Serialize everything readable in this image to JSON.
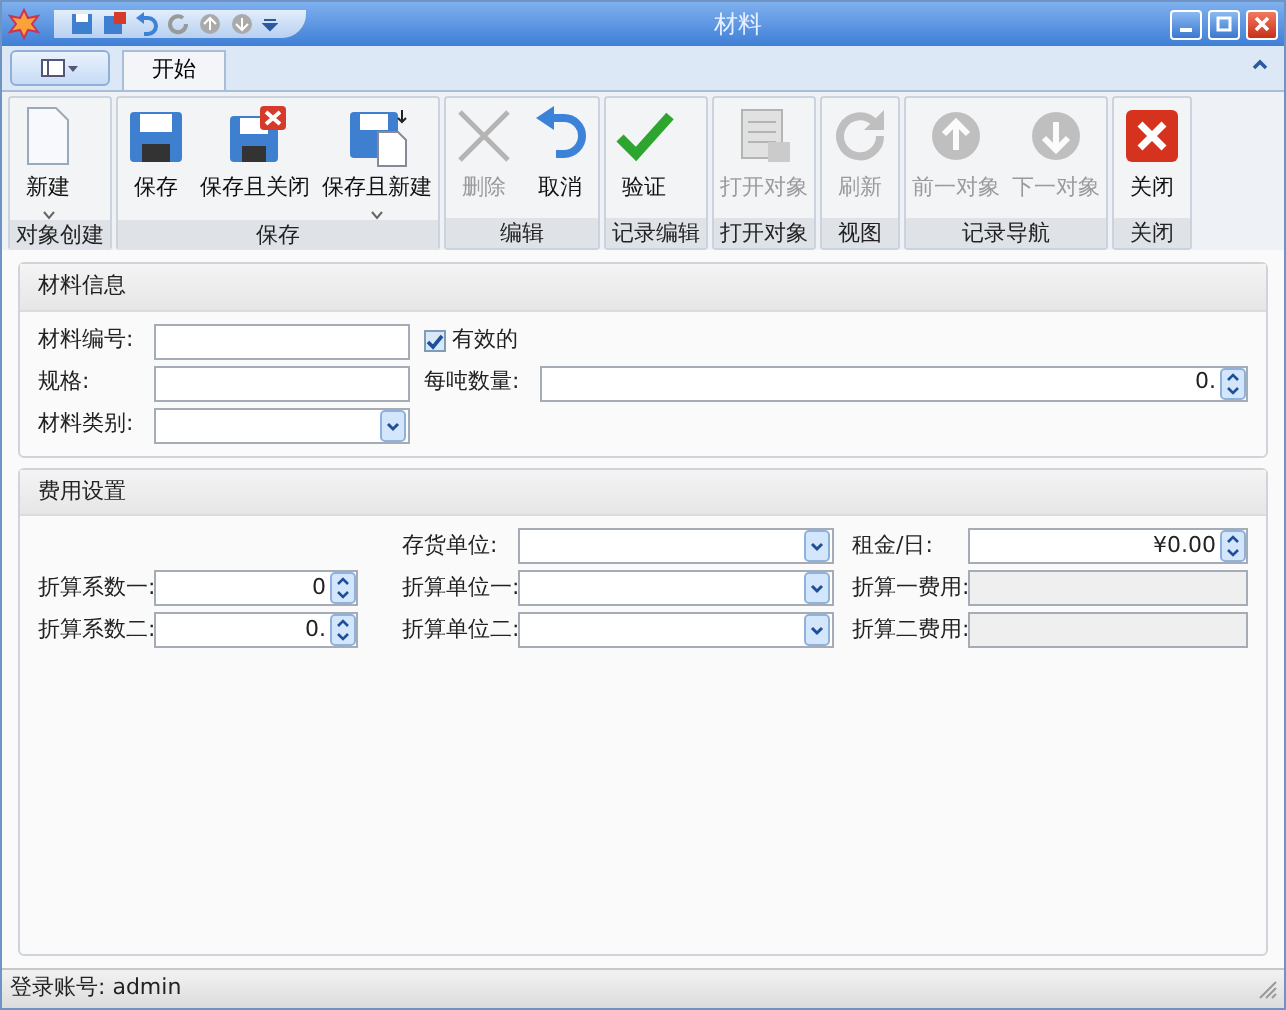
{
  "window": {
    "title": "材料"
  },
  "ribbon": {
    "tabs": [
      {
        "label": "开始",
        "selected": true
      }
    ],
    "groups": [
      {
        "label": "对象创建",
        "buttons": [
          {
            "label": "新建",
            "kind": "new",
            "disabled": false,
            "dropdown": true
          }
        ]
      },
      {
        "label": "保存",
        "buttons": [
          {
            "label": "保存",
            "kind": "save",
            "disabled": false,
            "dropdown": false
          },
          {
            "label": "保存且关闭",
            "kind": "save-close",
            "disabled": false,
            "dropdown": false
          },
          {
            "label": "保存且新建",
            "kind": "save-new",
            "disabled": false,
            "dropdown": true
          }
        ]
      },
      {
        "label": "编辑",
        "buttons": [
          {
            "label": "删除",
            "kind": "delete",
            "disabled": true,
            "dropdown": false
          },
          {
            "label": "取消",
            "kind": "undo",
            "disabled": false,
            "dropdown": false
          }
        ]
      },
      {
        "label": "记录编辑",
        "buttons": [
          {
            "label": "验证",
            "kind": "check",
            "disabled": false,
            "dropdown": false
          }
        ]
      },
      {
        "label": "打开对象",
        "buttons": [
          {
            "label": "打开对象",
            "kind": "open",
            "disabled": true,
            "dropdown": false
          }
        ]
      },
      {
        "label": "视图",
        "buttons": [
          {
            "label": "刷新",
            "kind": "refresh",
            "disabled": true,
            "dropdown": false
          }
        ]
      },
      {
        "label": "记录导航",
        "buttons": [
          {
            "label": "前一对象",
            "kind": "up",
            "disabled": true,
            "dropdown": false
          },
          {
            "label": "下一对象",
            "kind": "down",
            "disabled": true,
            "dropdown": false
          }
        ]
      },
      {
        "label": "关闭",
        "buttons": [
          {
            "label": "关闭",
            "kind": "close",
            "disabled": false,
            "dropdown": false
          }
        ]
      }
    ]
  },
  "sections": [
    {
      "title": "材料信息",
      "fields": [
        {
          "label": "材料编号:",
          "kind": "text"
        },
        {
          "label": "有效的",
          "kind": "checkbox",
          "checked": true
        },
        {
          "label": "规格:",
          "kind": "text"
        },
        {
          "label": "每吨数量:",
          "kind": "spin",
          "value": "0."
        },
        {
          "label": "材料类别:",
          "kind": "combo"
        }
      ]
    },
    {
      "title": "费用设置",
      "fields": [
        {
          "label": "存货单位:",
          "kind": "combo"
        },
        {
          "label": "租金/日:",
          "kind": "spin",
          "value": "¥0.00"
        },
        {
          "label": "折算系数一:",
          "kind": "spin",
          "value": "0"
        },
        {
          "label": "折算单位一:",
          "kind": "combo"
        },
        {
          "label": "折算一费用:",
          "kind": "readonly"
        },
        {
          "label": "折算系数二:",
          "kind": "spin",
          "value": "0."
        },
        {
          "label": "折算单位二:",
          "kind": "combo"
        },
        {
          "label": "折算二费用:",
          "kind": "readonly"
        }
      ]
    }
  ],
  "status_bar": {
    "text": "登录账号: admin"
  }
}
